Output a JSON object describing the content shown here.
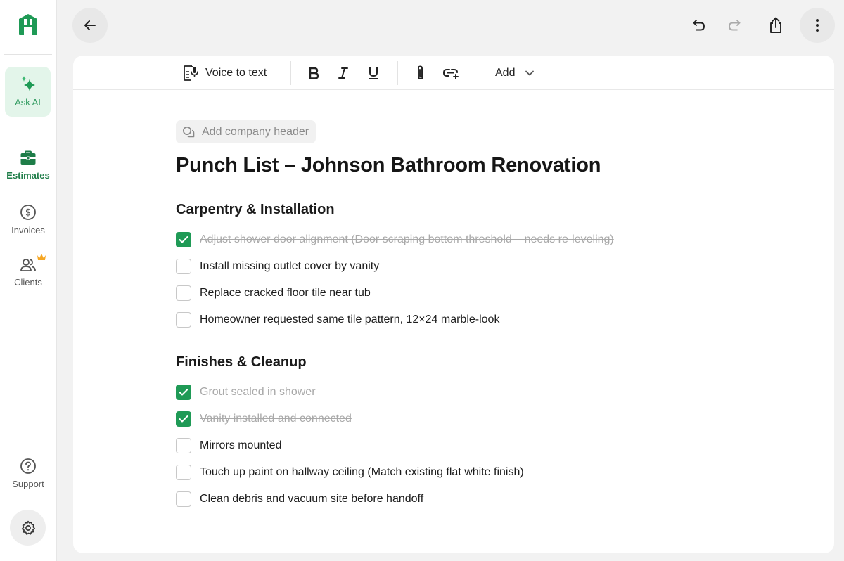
{
  "sidebar": {
    "ask_ai": "Ask AI",
    "items": [
      {
        "label": "Estimates"
      },
      {
        "label": "Invoices"
      },
      {
        "label": "Clients"
      },
      {
        "label": "Support"
      }
    ]
  },
  "toolbar": {
    "voice_to_text": "Voice to text",
    "add": "Add"
  },
  "document": {
    "company_header_placeholder": "Add company header",
    "title": "Punch List – Johnson Bathroom Renovation",
    "sections": [
      {
        "heading": "Carpentry & Installation",
        "tasks": [
          {
            "text": "Adjust shower door alignment (Door scraping bottom threshold – needs re-leveling)",
            "done": true
          },
          {
            "text": "Install missing outlet cover by vanity",
            "done": false
          },
          {
            "text": "Replace cracked floor tile near tub",
            "done": false
          },
          {
            "text": "Homeowner requested same tile pattern, 12×24 marble-look",
            "done": false
          }
        ]
      },
      {
        "heading": "Finishes & Cleanup",
        "tasks": [
          {
            "text": "Grout sealed in shower",
            "done": true
          },
          {
            "text": "Vanity installed and connected",
            "done": true
          },
          {
            "text": "Mirrors mounted",
            "done": false
          },
          {
            "text": "Touch up paint on hallway ceiling (Match existing flat white finish)",
            "done": false
          },
          {
            "text": "Clean debris and vacuum site before handoff",
            "done": false
          }
        ]
      }
    ]
  },
  "colors": {
    "brand_green": "#1f9a56",
    "ask_ai_bg": "#e3f5ea",
    "crown": "#f5a623"
  },
  "icons": [
    "logo-h-icon",
    "sparkle-icon",
    "briefcase-icon",
    "dollar-circle-icon",
    "users-icon",
    "crown-icon",
    "question-circle-icon",
    "gear-icon",
    "arrow-left-icon",
    "undo-icon",
    "redo-icon",
    "share-icon",
    "more-vertical-icon",
    "document-mic-icon",
    "bold-icon",
    "italic-icon",
    "underline-icon",
    "paperclip-icon",
    "link-add-icon",
    "chevron-down-icon",
    "comment-icon",
    "check-icon"
  ]
}
